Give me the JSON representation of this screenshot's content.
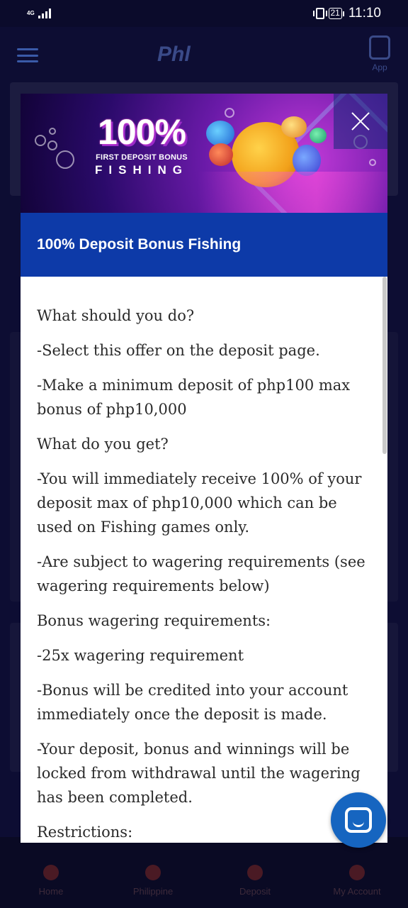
{
  "status_bar": {
    "network": "4G",
    "battery": "21",
    "time": "11:10"
  },
  "app_background": {
    "logo": "Phl",
    "app_button_label": "App",
    "bottom_nav": [
      "Home",
      "Philippine",
      "Deposit",
      "My Account"
    ]
  },
  "modal": {
    "banner": {
      "percent": "100%",
      "line1": "FIRST DEPOSIT BONUS",
      "line2": "FISHING"
    },
    "title": "100% Deposit Bonus Fishing",
    "body": [
      "What should you do?",
      "-Select this offer on the deposit page.",
      "-Make a minimum deposit of php100 max bonus of php10,000",
      "What do you get?",
      "-You will immediately receive 100% of your deposit max of php10,000 which can be used on Fishing games only.",
      "-Are subject to wagering requirements (see wagering requirements below)",
      "Bonus wagering requirements:",
      "-25x wagering requirement",
      "-Bonus will be credited into your account immediately once the deposit is made.",
      "-Your deposit, bonus and winnings will be locked from withdrawal until the wagering has been completed.",
      "Restrictions:"
    ]
  },
  "colors": {
    "title_bar": "#0d3aa8",
    "chat_button": "#1665c0"
  }
}
